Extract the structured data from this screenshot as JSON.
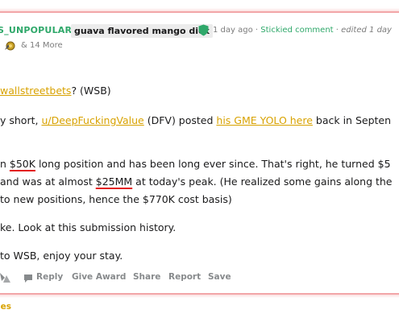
{
  "comment": {
    "author": "S_UNPOPULAR",
    "flair": "guava flavored mango dick",
    "time": "1 day ago",
    "separator": "·",
    "stickied": "Stickied comment",
    "edited": "edited 1 day",
    "more_awards": "& 14 More"
  },
  "body": {
    "p1_link": "wallstreetbets",
    "p1_rest": "? (WSB)",
    "p2_a": "y short, ",
    "p2_user": "u/DeepFuckingValue",
    "p2_b": " (DFV) posted ",
    "p2_link": "his GME YOLO here",
    "p2_c": " back in Septen",
    "p3_a": "n ",
    "p3_amount": "$50K",
    "p3_b": " long position and has been long ever since. That's right, he turned $5",
    "p4_a": "and was at almost ",
    "p4_amount": "$25MM",
    "p4_b": " at today's peak. (He realized some gains along the",
    "p5": "to new positions, hence the $770K cost basis)",
    "p6": "ke. Look at this submission history.",
    "p7": "to WSB, enjoy your stay."
  },
  "actions": {
    "reply": "Reply",
    "give_award": "Give Award",
    "share": "Share",
    "report": "Report",
    "save": "Save"
  },
  "footer": {
    "replies": "ies"
  },
  "colors": {
    "link": "#d8a200",
    "stickied": "#2fa86a",
    "highlight_border": "#f2a6a8",
    "underline_red": "#e32020"
  }
}
